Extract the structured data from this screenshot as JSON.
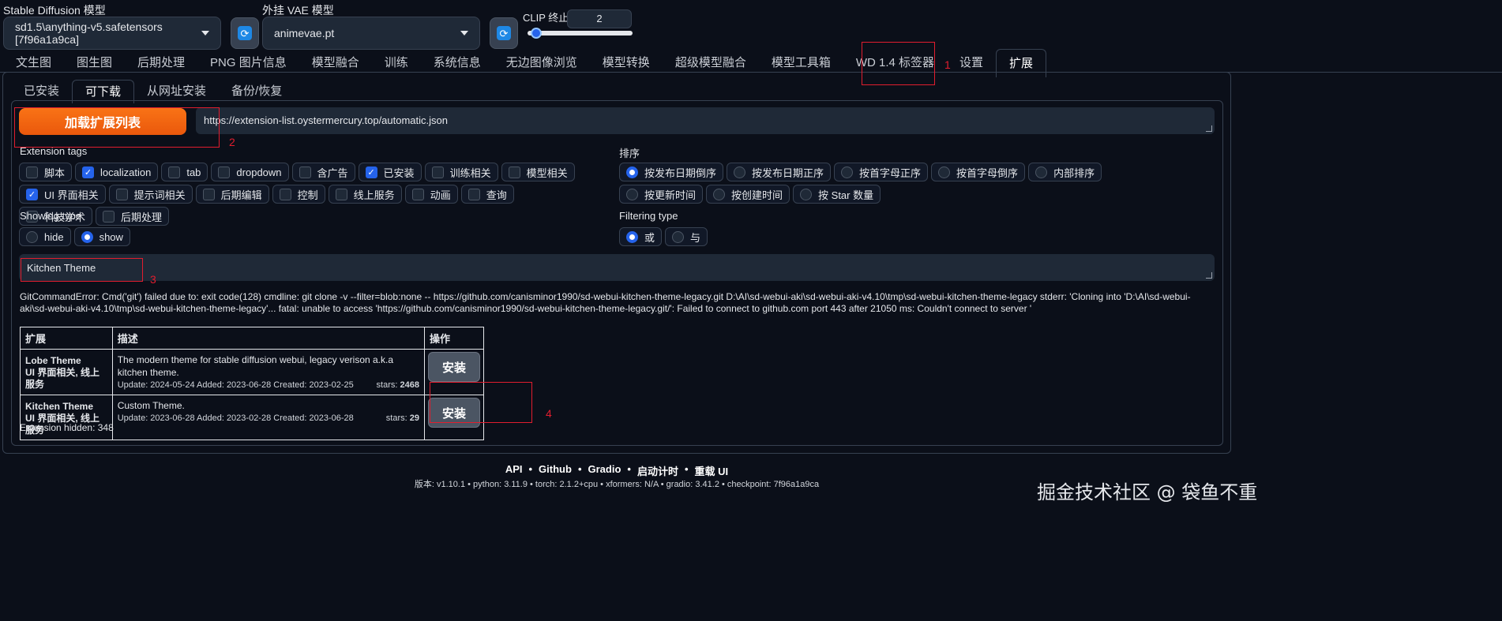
{
  "top": {
    "sd_model_label": "Stable Diffusion 模型",
    "sd_model_value": "sd1.5\\anything-v5.safetensors [7f96a1a9ca]",
    "vae_label": "外挂 VAE 模型",
    "vae_value": "animevae.pt",
    "clip_label": "CLIP 终止层数",
    "clip_value": "2",
    "clip_slider_fraction": 0.0
  },
  "tabs": [
    "文生图",
    "图生图",
    "后期处理",
    "PNG 图片信息",
    "模型融合",
    "训练",
    "系统信息",
    "无边图像浏览",
    "模型转换",
    "超级模型融合",
    "模型工具箱",
    "WD 1.4 标签器",
    "设置",
    "扩展"
  ],
  "subtabs": [
    "已安装",
    "可下载",
    "从网址安装",
    "备份/恢复"
  ],
  "load_button": "加载扩展列表",
  "url_value": "https://extension-list.oystermercury.top/automatic.json",
  "extension_tags": {
    "label": "Extension tags",
    "items": [
      {
        "label": "脚本",
        "checked": false
      },
      {
        "label": "localization",
        "checked": true
      },
      {
        "label": "tab",
        "checked": false
      },
      {
        "label": "dropdown",
        "checked": false
      },
      {
        "label": "含广告",
        "checked": false
      },
      {
        "label": "已安装",
        "checked": true
      },
      {
        "label": "训练相关",
        "checked": false
      },
      {
        "label": "模型相关",
        "checked": false
      },
      {
        "label": "UI 界面相关",
        "checked": true
      },
      {
        "label": "提示词相关",
        "checked": false
      },
      {
        "label": "后期编辑",
        "checked": false
      },
      {
        "label": "控制",
        "checked": false
      },
      {
        "label": "线上服务",
        "checked": false
      },
      {
        "label": "动画",
        "checked": false
      },
      {
        "label": "查询",
        "checked": false
      },
      {
        "label": "科技学术",
        "checked": false
      },
      {
        "label": "后期处理",
        "checked": false
      }
    ]
  },
  "sort": {
    "label": "排序",
    "items": [
      {
        "label": "按发布日期倒序",
        "selected": true
      },
      {
        "label": "按发布日期正序",
        "selected": false
      },
      {
        "label": "按首字母正序",
        "selected": false
      },
      {
        "label": "按首字母倒序",
        "selected": false
      },
      {
        "label": "内部排序",
        "selected": false
      },
      {
        "label": "按更新时间",
        "selected": false
      },
      {
        "label": "按创建时间",
        "selected": false
      },
      {
        "label": "按 Star 数量",
        "selected": false
      }
    ]
  },
  "showing_type": {
    "label": "Showing type",
    "items": [
      {
        "label": "hide",
        "selected": false
      },
      {
        "label": "show",
        "selected": true
      }
    ]
  },
  "filtering_type": {
    "label": "Filtering type",
    "items": [
      {
        "label": "或",
        "selected": true
      },
      {
        "label": "与",
        "selected": false
      }
    ]
  },
  "search_value": "Kitchen Theme",
  "error_text": "GitCommandError: Cmd('git') failed due to: exit code(128) cmdline: git clone -v --filter=blob:none -- https://github.com/canisminor1990/sd-webui-kitchen-theme-legacy.git D:\\AI\\sd-webui-aki\\sd-webui-aki-v4.10\\tmp\\sd-webui-kitchen-theme-legacy stderr: 'Cloning into 'D:\\AI\\sd-webui-aki\\sd-webui-aki-v4.10\\tmp\\sd-webui-kitchen-theme-legacy'... fatal: unable to access 'https://github.com/canisminor1990/sd-webui-kitchen-theme-legacy.git/': Failed to connect to github.com port 443 after 21050 ms: Couldn't connect to server '",
  "table": {
    "headers": [
      "扩展",
      "描述",
      "操作"
    ],
    "rows": [
      {
        "name": "Lobe Theme",
        "tags": "UI 界面相关, 线上服务",
        "desc": "The modern theme for stable diffusion webui, legacy verison a.k.a kitchen theme.",
        "dates": "Update: 2024-05-24 Added: 2023-06-28 Created: 2023-02-25",
        "stars_label": "stars:",
        "stars": "2468",
        "action": "安装"
      },
      {
        "name": "Kitchen Theme",
        "tags": "UI 界面相关, 线上服务",
        "desc": "Custom Theme.",
        "dates": "Update: 2023-06-28 Added: 2023-02-28 Created: 2023-06-28",
        "stars_label": "stars:",
        "stars": "29",
        "action": "安装"
      }
    ]
  },
  "extension_hidden": "Extension hidden: 348",
  "annotations": [
    "1",
    "2",
    "3",
    "4"
  ],
  "footer": {
    "links": [
      "API",
      "•",
      "Github",
      "•",
      "Gradio",
      "•",
      "启动计时",
      "•",
      "重载 UI"
    ],
    "meta": "版本: v1.10.1  •  python: 3.11.9  •  torch: 2.1.2+cpu  •  xformers: N/A  •  gradio: 3.41.2  •  checkpoint: 7f96a1a9ca"
  },
  "watermark": "掘金技术社区 @ 袋鱼不重",
  "colors": {
    "accent": "#2563eb",
    "orange": "#f97316",
    "annotation_red": "#e11d2e",
    "background": "#0b0f19"
  }
}
